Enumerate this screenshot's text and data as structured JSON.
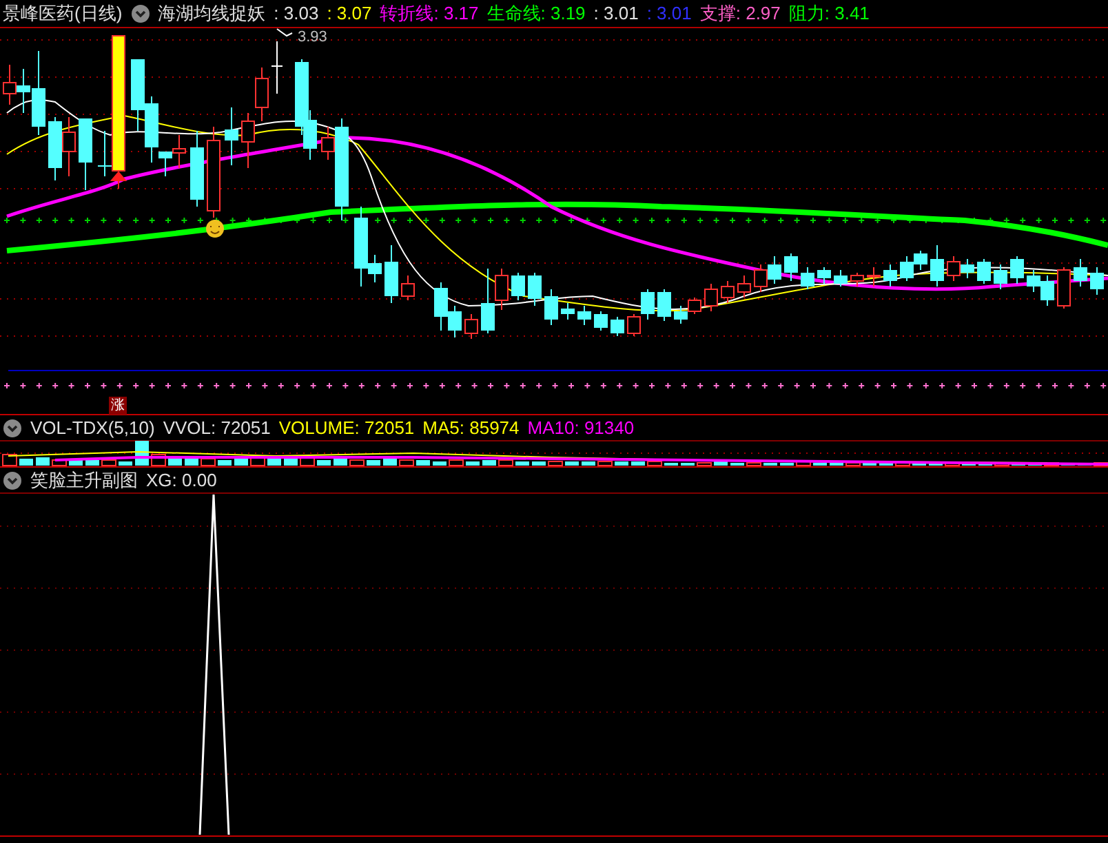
{
  "main_panel": {
    "stock_name": "景峰医药(日线)",
    "indicator": "海湖均线捉妖",
    "legend": [
      {
        "text": ": 3.03",
        "color": "#e0e0e0"
      },
      {
        "text": ": 3.07",
        "color": "#ffff00"
      },
      {
        "text": "转折线: 3.17",
        "color": "#ff00ff"
      },
      {
        "text": "生命线: 3.19",
        "color": "#00ff00"
      },
      {
        "text": ": 3.01",
        "color": "#e0e0e0"
      },
      {
        "text": ": 3.01",
        "color": "#3030ff"
      },
      {
        "text": "支撑: 2.97",
        "color": "#ff5fc8"
      },
      {
        "text": "阻力: 3.41",
        "color": "#00ff00"
      }
    ],
    "high_label": "3.93",
    "signal_label": "涨"
  },
  "volume_panel": {
    "indicator": "VOL-TDX(5,10)",
    "legend": [
      {
        "text": "VVOL: 72051",
        "color": "#e0e0e0"
      },
      {
        "text": "VOLUME: 72051",
        "color": "#ffff00"
      },
      {
        "text": "MA5: 85974",
        "color": "#ffff00"
      },
      {
        "text": "MA10: 91340",
        "color": "#ff00ff"
      }
    ]
  },
  "sub_panel": {
    "indicator": "笑脸主升副图",
    "legend": [
      {
        "text": "XG: 0.00",
        "color": "#e0e0e0"
      }
    ]
  }
}
